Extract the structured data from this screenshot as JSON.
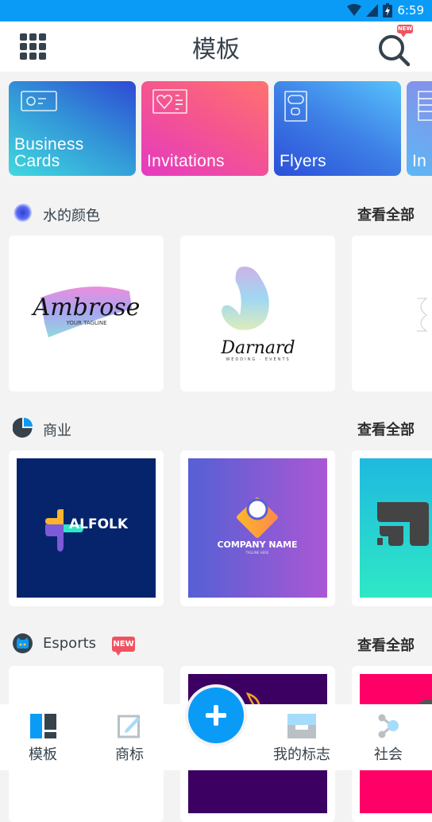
{
  "status_bar": {
    "time": "6:59",
    "icons": [
      "wifi-icon",
      "cell-signal-icon",
      "battery-charging-icon"
    ]
  },
  "app_bar": {
    "title": "模板",
    "menu_icon": "grid-menu-icon",
    "search_icon": "search-icon",
    "search_badge": "NEW"
  },
  "categories": [
    {
      "label": "Business\nCards",
      "icon": "business-card-icon",
      "gradient": [
        "#40d9df",
        "#2e4ad4"
      ]
    },
    {
      "label": "Invitations",
      "icon": "invitation-icon",
      "gradient": [
        "#e53ac2",
        "#ff7270"
      ]
    },
    {
      "label": "Flyers",
      "icon": "flyer-icon",
      "gradient": [
        "#2c4fd8",
        "#58c2fb"
      ]
    },
    {
      "label": "In",
      "icon": "infographic-icon",
      "gradient": [
        "#9c7be6",
        "#5cb8f3"
      ]
    }
  ],
  "sections": [
    {
      "title": "水的颜色",
      "icon": "watercolor-icon",
      "view_all": "查看全部",
      "cards": [
        {
          "logo_text": "Ambrose",
          "tagline": "YOUR TAGLINE"
        },
        {
          "logo_text": "Darnard",
          "tagline": "WEDDING · EVENTS"
        },
        {
          "logo_text": ""
        }
      ]
    },
    {
      "title": "商业",
      "icon": "pie-chart-icon",
      "view_all": "查看全部",
      "cards": [
        {
          "logo_text": "ALFOLK",
          "bg": "#06246c"
        },
        {
          "logo_text": "COMPANY NAME",
          "tagline": "TAGLINE HERE",
          "bg": [
            "#5560d4",
            "#aa58d4"
          ]
        },
        {
          "logo_text": "",
          "bg": [
            "#1fb9e0",
            "#2ee8c5"
          ]
        }
      ]
    },
    {
      "title": "Esports",
      "icon": "cat-mascot-icon",
      "badge": "NEW",
      "view_all": "查看全部",
      "cards": [
        {
          "bg": "#ffffff"
        },
        {
          "bg": "#3b0062"
        },
        {
          "bg": "#ff0066"
        }
      ]
    }
  ],
  "bottom_nav": {
    "items": [
      {
        "label": "模板",
        "icon": "templates-icon",
        "active": true
      },
      {
        "label": "商标",
        "icon": "edit-logo-icon",
        "active": false
      },
      {
        "label": "我的标志",
        "icon": "my-logos-tray-icon",
        "active": false
      },
      {
        "label": "社会",
        "icon": "share-icon",
        "active": false
      }
    ],
    "fab_icon": "plus-icon"
  },
  "colors": {
    "accent": "#0a9bf7",
    "text_dark": "#36424c",
    "badge": "#f05360",
    "background": "#f3f3f3"
  }
}
